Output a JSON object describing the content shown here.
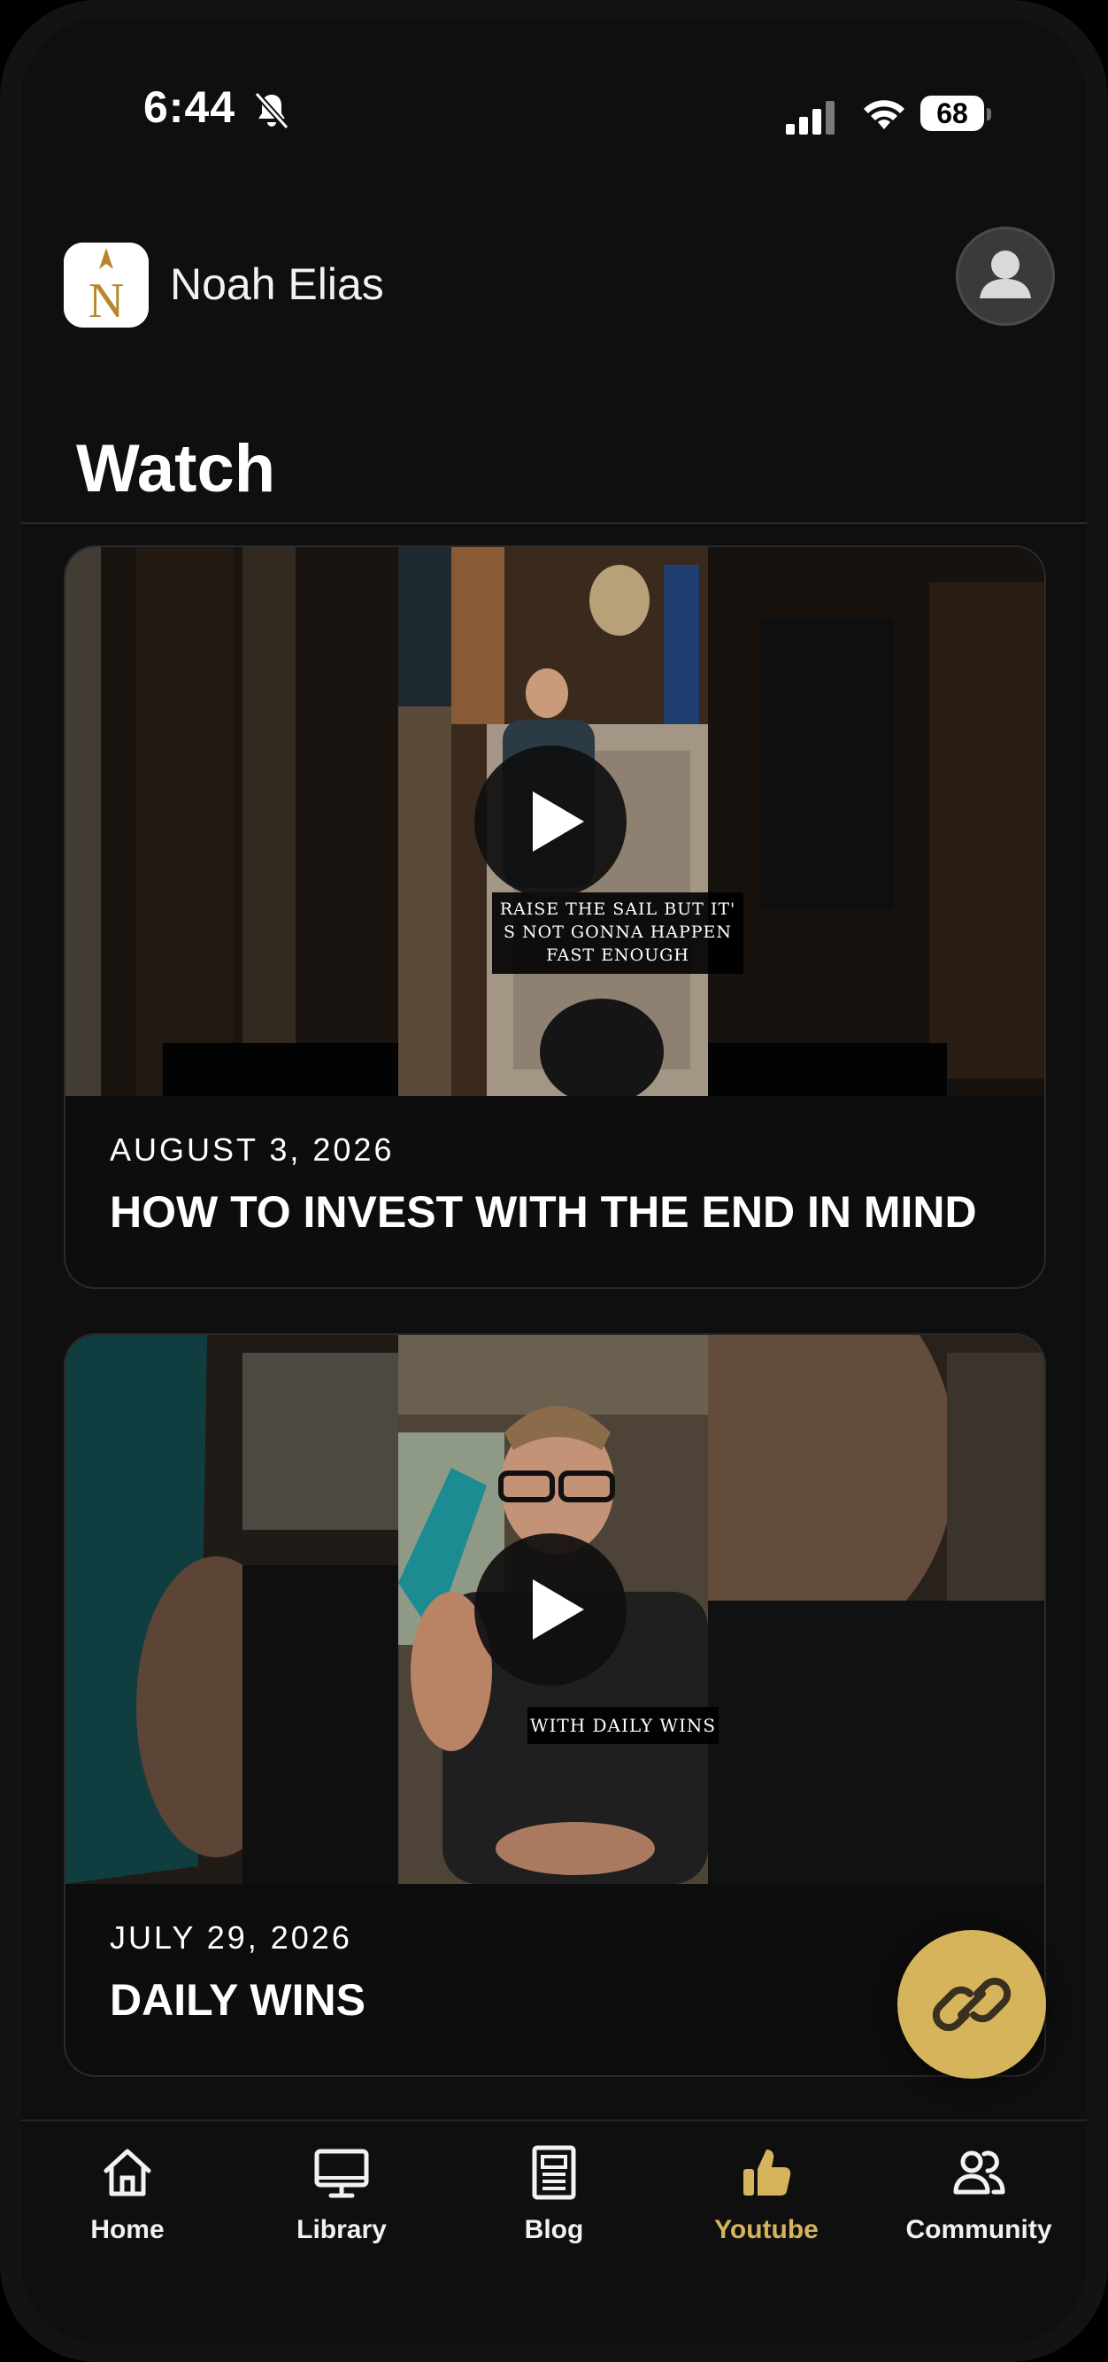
{
  "status_bar": {
    "time": "6:44",
    "battery": "68"
  },
  "header": {
    "name": "Noah Elias"
  },
  "page": {
    "title": "Watch"
  },
  "videos": [
    {
      "date": "AUGUST 3, 2026",
      "title": "HOW TO INVEST WITH THE END IN MIND",
      "caption": [
        "RAISE THE SAIL BUT IT'",
        "S NOT GONNA HAPPEN",
        "FAST ENOUGH"
      ]
    },
    {
      "date": "JULY 29, 2026",
      "title": "DAILY WINS",
      "caption": [
        "WITH DAILY WINS"
      ]
    }
  ],
  "bottom_nav": [
    {
      "label": "Home",
      "icon": "home-icon"
    },
    {
      "label": "Library",
      "icon": "monitor-icon"
    },
    {
      "label": "Blog",
      "icon": "newspaper-icon"
    },
    {
      "label": "Youtube",
      "icon": "thumbs-up-icon",
      "active": true
    },
    {
      "label": "Community",
      "icon": "users-icon"
    }
  ],
  "colors": {
    "accent": "#d6b45c",
    "background": "#0f0f0f",
    "card_border": "#2a2a2a"
  }
}
